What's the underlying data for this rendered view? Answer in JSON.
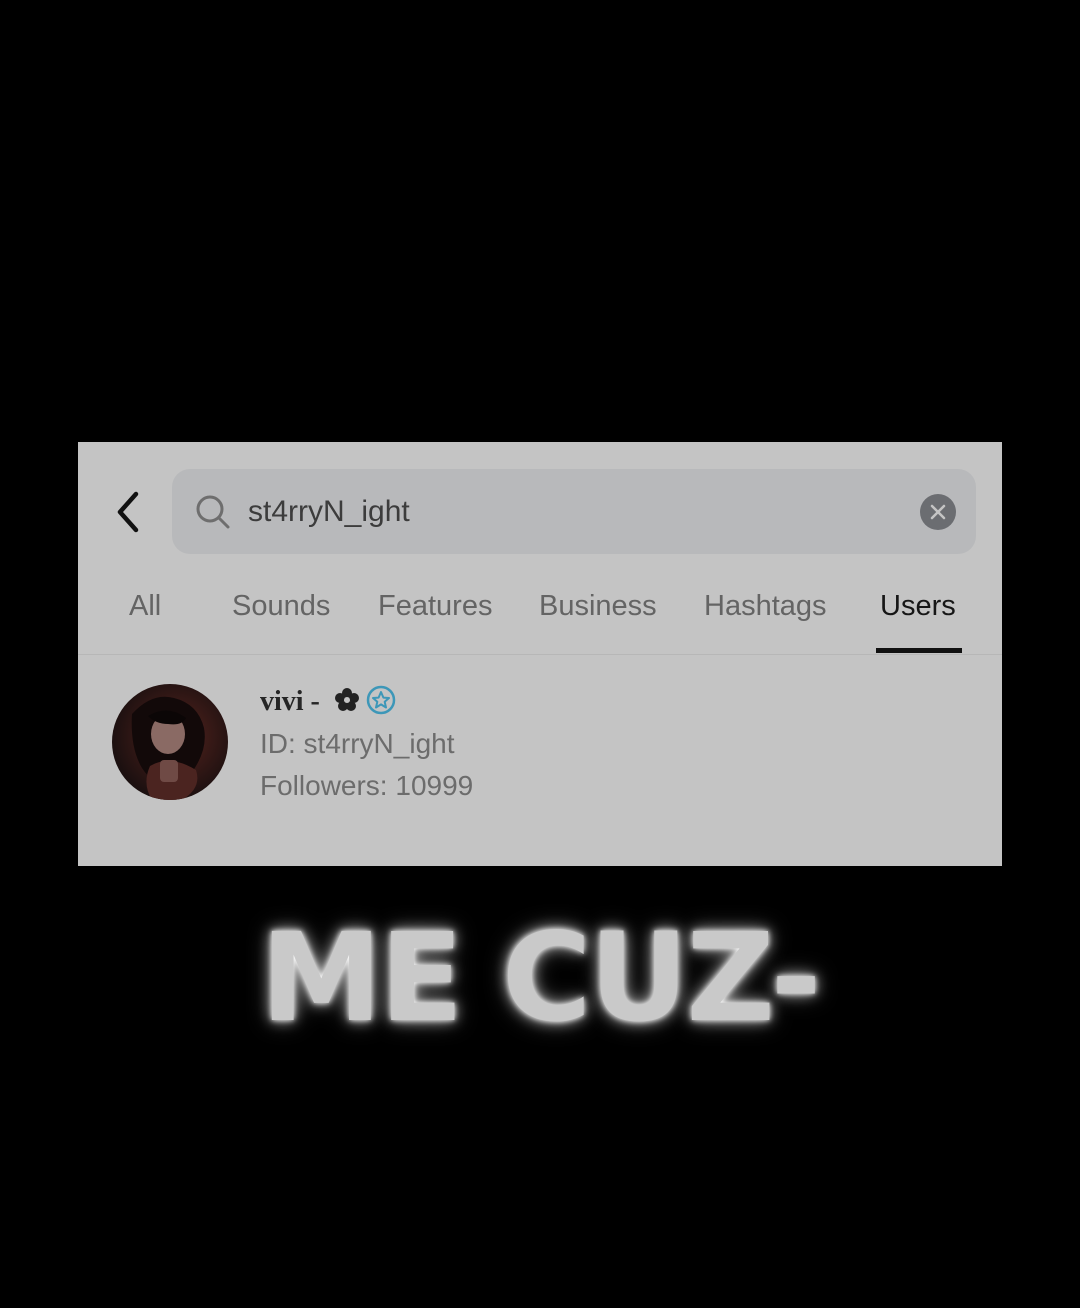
{
  "search": {
    "query": "st4rryN_ight"
  },
  "tabs": [
    {
      "label": "All",
      "active": false
    },
    {
      "label": "Sounds",
      "active": false
    },
    {
      "label": "Features",
      "active": false
    },
    {
      "label": "Business",
      "active": false
    },
    {
      "label": "Hashtags",
      "active": false
    },
    {
      "label": "Users",
      "active": true
    }
  ],
  "result": {
    "display_name": "vivi -",
    "name_icons": [
      "flower-icon",
      "verified-icon"
    ],
    "id_text": "ID: st4rryN_ight",
    "followers_text": "Followers: 10999"
  },
  "caption": "ME CUZ-",
  "colors": {
    "panel_background": "#c4c4c4",
    "search_background": "#b8b9bb",
    "verified_accent": "#3d97b8",
    "active_tab": "#161616",
    "inactive_tab": "#646464",
    "page_background": "#000000"
  }
}
